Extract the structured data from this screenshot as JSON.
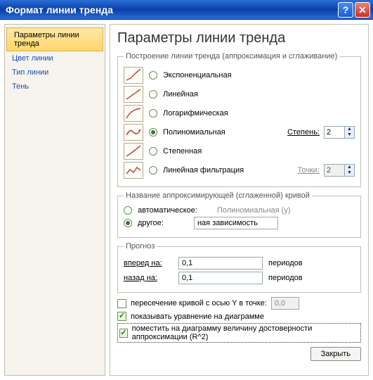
{
  "window": {
    "title": "Формат линии тренда"
  },
  "sidebar": {
    "items": [
      {
        "label": "Параметры линии тренда",
        "active": true
      },
      {
        "label": "Цвет линии",
        "active": false
      },
      {
        "label": "Тип линии",
        "active": false
      },
      {
        "label": "Тень",
        "active": false
      }
    ]
  },
  "page": {
    "heading": "Параметры линии тренда",
    "build_fieldset": "Построение линии тренда (аппроксимация и сглаживание)",
    "trend_types": {
      "exponential": {
        "label": "Экспоненциальная",
        "checked": false
      },
      "linear": {
        "label": "Линейная",
        "checked": false
      },
      "logarithmic": {
        "label": "Логарифмическая",
        "checked": false
      },
      "polynomial": {
        "label": "Полиномиальная",
        "checked": true,
        "degree_label": "Степень:",
        "degree_value": "2"
      },
      "power": {
        "label": "Степенная",
        "checked": false
      },
      "moving_avg": {
        "label": "Линейная фильтрация",
        "checked": false,
        "points_label": "Точки:",
        "points_value": "2",
        "points_enabled": false
      }
    },
    "name_fieldset": "Название аппроксимирующей (сглаженной) кривой",
    "name": {
      "auto": {
        "label": "автоматическое:",
        "checked": false,
        "preview": "Полиномиальная (y)"
      },
      "other": {
        "label": "другое:",
        "checked": true,
        "value": "ная зависимость"
      }
    },
    "forecast_fieldset": "Прогноз",
    "forecast": {
      "forward": {
        "label": "вперед на:",
        "value": "0,1",
        "unit": "периодов"
      },
      "backward": {
        "label": "назад на:",
        "value": "0,1",
        "unit": "периодов"
      }
    },
    "checks": {
      "intercept": {
        "label": "пересечение кривой с осью Y в точке:",
        "checked": false,
        "value": "0,0"
      },
      "show_eq": {
        "label": "показывать уравнение на диаграмме",
        "checked": true
      },
      "show_r2": {
        "label": "поместить на диаграмму величину достоверности аппроксимации (R^2)",
        "checked": true,
        "highlighted": true
      }
    },
    "close_btn": "Закрыть"
  }
}
